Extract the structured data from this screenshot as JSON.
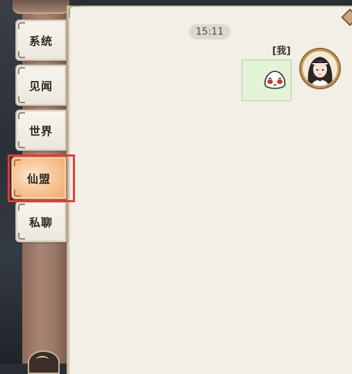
{
  "sidebar": {
    "tabs": [
      {
        "label": "系统",
        "active": false
      },
      {
        "label": "见闻",
        "active": false
      },
      {
        "label": "世界",
        "active": false
      },
      {
        "label": "仙盟",
        "active": true
      },
      {
        "label": "私聊",
        "active": false
      }
    ]
  },
  "chat": {
    "timestamp": "15:11",
    "messages": [
      {
        "sender_label": "[我]",
        "content_type": "sticker",
        "sticker_icon": "smiling-dumpling-face-icon",
        "bubble_color": "#e2f3d6"
      }
    ]
  },
  "colors": {
    "active_tab": "#f0a76b",
    "highlight_border": "#e23b3b",
    "panel_background": "#f2efe6"
  }
}
